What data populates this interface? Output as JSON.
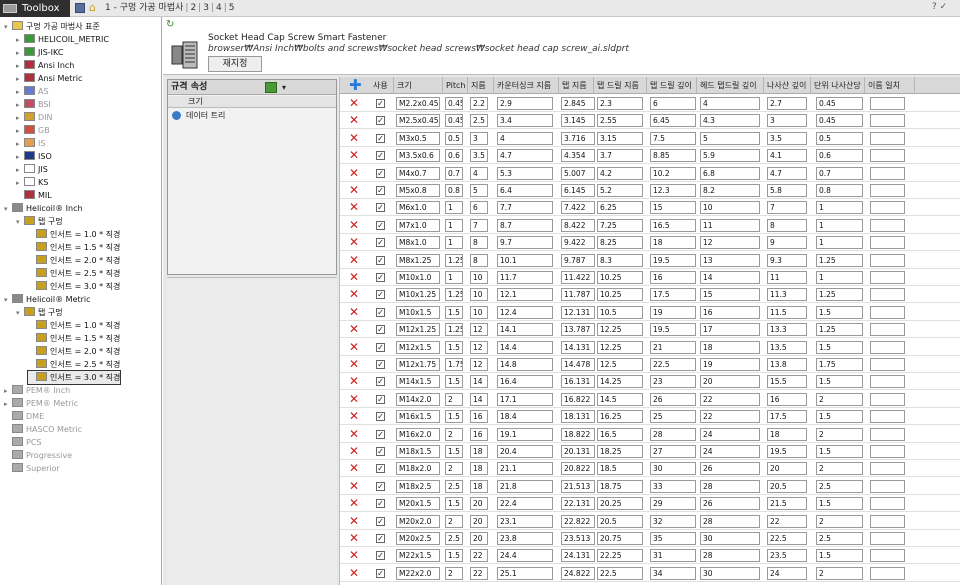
{
  "app": {
    "title": "Toolbox"
  },
  "breadcrumb": [
    "1 - 구멍 가공 마법사",
    "2",
    "3",
    "4",
    "5"
  ],
  "top_icons": "? ✓",
  "tree": [
    {
      "label": "구멍 가공 마법사 표준",
      "exp": "▾",
      "lvl": 0,
      "color": "#e8c84a",
      "dis": false
    },
    {
      "label": "HELICOIL_METRIC",
      "exp": "▸",
      "lvl": 1,
      "color": "#3a9a3a",
      "dis": false
    },
    {
      "label": "JIS-IKC",
      "exp": "▸",
      "lvl": 1,
      "color": "#3a9a3a",
      "dis": false
    },
    {
      "label": "Ansi Inch",
      "exp": "▸",
      "lvl": 1,
      "color": "#b03040",
      "dis": false
    },
    {
      "label": "Ansi Metric",
      "exp": "▸",
      "lvl": 1,
      "color": "#b03040",
      "dis": false
    },
    {
      "label": "AS",
      "exp": "▸",
      "lvl": 1,
      "color": "#6a7ad0",
      "dis": true
    },
    {
      "label": "BSI",
      "exp": "▸",
      "lvl": 1,
      "color": "#c05060",
      "dis": true
    },
    {
      "label": "DIN",
      "exp": "▸",
      "lvl": 1,
      "color": "#d0a030",
      "dis": true
    },
    {
      "label": "GB",
      "exp": "▸",
      "lvl": 1,
      "color": "#d05040",
      "dis": true
    },
    {
      "label": "IS",
      "exp": "▸",
      "lvl": 1,
      "color": "#e0a050",
      "dis": true
    },
    {
      "label": "ISO",
      "exp": "▸",
      "lvl": 1,
      "color": "#203a8a",
      "dis": false
    },
    {
      "label": "JIS",
      "exp": "▸",
      "lvl": 1,
      "color": "#ffffff",
      "dis": false
    },
    {
      "label": "KS",
      "exp": "▸",
      "lvl": 1,
      "color": "#ffffff",
      "dis": false
    },
    {
      "label": "MIL",
      "exp": "",
      "lvl": 1,
      "color": "#b03040",
      "dis": false
    },
    {
      "label": "Helicoil® Inch",
      "exp": "▾",
      "lvl": 0,
      "color": "#8a8a8a",
      "dis": false
    },
    {
      "label": "탭 구멍",
      "exp": "▾",
      "lvl": 1,
      "color": "#c8a020",
      "dis": false
    },
    {
      "label": "인서트 = 1.0 * 직경",
      "exp": "",
      "lvl": 2,
      "color": "#c8a020",
      "dis": false
    },
    {
      "label": "인서트 = 1.5 * 직경",
      "exp": "",
      "lvl": 2,
      "color": "#c8a020",
      "dis": false
    },
    {
      "label": "인서트 = 2.0 * 직경",
      "exp": "",
      "lvl": 2,
      "color": "#c8a020",
      "dis": false
    },
    {
      "label": "인서트 = 2.5 * 직경",
      "exp": "",
      "lvl": 2,
      "color": "#c8a020",
      "dis": false
    },
    {
      "label": "인서트 = 3.0 * 직경",
      "exp": "",
      "lvl": 2,
      "color": "#c8a020",
      "dis": false
    },
    {
      "label": "Helicoil® Metric",
      "exp": "▾",
      "lvl": 0,
      "color": "#8a8a8a",
      "dis": false
    },
    {
      "label": "탭 구멍",
      "exp": "▾",
      "lvl": 1,
      "color": "#c8a020",
      "dis": false
    },
    {
      "label": "인서트 = 1.0 * 직경",
      "exp": "",
      "lvl": 2,
      "color": "#c8a020",
      "dis": false
    },
    {
      "label": "인서트 = 1.5 * 직경",
      "exp": "",
      "lvl": 2,
      "color": "#c8a020",
      "dis": false
    },
    {
      "label": "인서트 = 2.0 * 직경",
      "exp": "",
      "lvl": 2,
      "color": "#c8a020",
      "dis": false
    },
    {
      "label": "인서트 = 2.5 * 직경",
      "exp": "",
      "lvl": 2,
      "color": "#c8a020",
      "dis": false
    },
    {
      "label": "인서트 = 3.0 * 직경",
      "exp": "",
      "lvl": 2,
      "color": "#c8a020",
      "dis": false,
      "sel": true
    },
    {
      "label": "PEM® Inch",
      "exp": "▸",
      "lvl": 0,
      "color": "#aaaaaa",
      "dis": true
    },
    {
      "label": "PEM® Metric",
      "exp": "▸",
      "lvl": 0,
      "color": "#aaaaaa",
      "dis": true
    },
    {
      "label": "DME",
      "exp": "",
      "lvl": 0,
      "color": "#aaaaaa",
      "dis": true
    },
    {
      "label": "HASCO Metric",
      "exp": "",
      "lvl": 0,
      "color": "#aaaaaa",
      "dis": true
    },
    {
      "label": "PCS",
      "exp": "",
      "lvl": 0,
      "color": "#aaaaaa",
      "dis": true
    },
    {
      "label": "Progressive",
      "exp": "",
      "lvl": 0,
      "color": "#aaaaaa",
      "dis": true
    },
    {
      "label": "Superior",
      "exp": "",
      "lvl": 0,
      "color": "#aaaaaa",
      "dis": true
    }
  ],
  "part": {
    "title": "Socket Head Cap Screw Smart Fastener",
    "path": "browser₩Ansi Inch₩bolts and screws₩socket head screws₩socket head cap screw_ai.sldprt",
    "reset_label": "재지정"
  },
  "props": {
    "header": "규격 속성",
    "row1": "크기",
    "row2": "데이터 트리"
  },
  "grid": {
    "columns": [
      "사용",
      "크기",
      "Pitch",
      "지름",
      "카운터싱크 지름",
      "탭 지름",
      "탭 드릴 지름",
      "탭 드릴 깊이",
      "헤드 탭드릴 깊이",
      "나사산 깊이",
      "단위 나사산당",
      "이름 일치"
    ],
    "rows": [
      [
        "M2.2x0.45",
        "0.45",
        "2.2",
        "2.9",
        "2.845",
        "2.3",
        "6",
        "4",
        "2.7",
        "0.45",
        ""
      ],
      [
        "M2.5x0.45",
        "0.45",
        "2.5",
        "3.4",
        "3.145",
        "2.55",
        "6.45",
        "4.3",
        "3",
        "0.45",
        ""
      ],
      [
        "M3x0.5",
        "0.5",
        "3",
        "4",
        "3.716",
        "3.15",
        "7.5",
        "5",
        "3.5",
        "0.5",
        ""
      ],
      [
        "M3.5x0.6",
        "0.6",
        "3.5",
        "4.7",
        "4.354",
        "3.7",
        "8.85",
        "5.9",
        "4.1",
        "0.6",
        ""
      ],
      [
        "M4x0.7",
        "0.7",
        "4",
        "5.3",
        "5.007",
        "4.2",
        "10.2",
        "6.8",
        "4.7",
        "0.7",
        ""
      ],
      [
        "M5x0.8",
        "0.8",
        "5",
        "6.4",
        "6.145",
        "5.2",
        "12.3",
        "8.2",
        "5.8",
        "0.8",
        ""
      ],
      [
        "M6x1.0",
        "1",
        "6",
        "7.7",
        "7.422",
        "6.25",
        "15",
        "10",
        "7",
        "1",
        ""
      ],
      [
        "M7x1.0",
        "1",
        "7",
        "8.7",
        "8.422",
        "7.25",
        "16.5",
        "11",
        "8",
        "1",
        ""
      ],
      [
        "M8x1.0",
        "1",
        "8",
        "9.7",
        "9.422",
        "8.25",
        "18",
        "12",
        "9",
        "1",
        ""
      ],
      [
        "M8x1.25",
        "1.25",
        "8",
        "10.1",
        "9.787",
        "8.3",
        "19.5",
        "13",
        "9.3",
        "1.25",
        ""
      ],
      [
        "M10x1.0",
        "1",
        "10",
        "11.7",
        "11.422",
        "10.25",
        "16",
        "14",
        "11",
        "1",
        ""
      ],
      [
        "M10x1.25",
        "1.25",
        "10",
        "12.1",
        "11.787",
        "10.25",
        "17.5",
        "15",
        "11.3",
        "1.25",
        ""
      ],
      [
        "M10x1.5",
        "1.5",
        "10",
        "12.4",
        "12.131",
        "10.5",
        "19",
        "16",
        "11.5",
        "1.5",
        ""
      ],
      [
        "M12x1.25",
        "1.25",
        "12",
        "14.1",
        "13.787",
        "12.25",
        "19.5",
        "17",
        "13.3",
        "1.25",
        ""
      ],
      [
        "M12x1.5",
        "1.5",
        "12",
        "14.4",
        "14.131",
        "12.25",
        "21",
        "18",
        "13.5",
        "1.5",
        ""
      ],
      [
        "M12x1.75",
        "1.75",
        "12",
        "14.8",
        "14.478",
        "12.5",
        "22.5",
        "19",
        "13.8",
        "1.75",
        ""
      ],
      [
        "M14x1.5",
        "1.5",
        "14",
        "16.4",
        "16.131",
        "14.25",
        "23",
        "20",
        "15.5",
        "1.5",
        ""
      ],
      [
        "M14x2.0",
        "2",
        "14",
        "17.1",
        "16.822",
        "14.5",
        "26",
        "22",
        "16",
        "2",
        ""
      ],
      [
        "M16x1.5",
        "1.5",
        "16",
        "18.4",
        "18.131",
        "16.25",
        "25",
        "22",
        "17.5",
        "1.5",
        ""
      ],
      [
        "M16x2.0",
        "2",
        "16",
        "19.1",
        "18.822",
        "16.5",
        "28",
        "24",
        "18",
        "2",
        ""
      ],
      [
        "M18x1.5",
        "1.5",
        "18",
        "20.4",
        "20.131",
        "18.25",
        "27",
        "24",
        "19.5",
        "1.5",
        ""
      ],
      [
        "M18x2.0",
        "2",
        "18",
        "21.1",
        "20.822",
        "18.5",
        "30",
        "26",
        "20",
        "2",
        ""
      ],
      [
        "M18x2.5",
        "2.5",
        "18",
        "21.8",
        "21.513",
        "18.75",
        "33",
        "28",
        "20.5",
        "2.5",
        ""
      ],
      [
        "M20x1.5",
        "1.5",
        "20",
        "22.4",
        "22.131",
        "20.25",
        "29",
        "26",
        "21.5",
        "1.5",
        ""
      ],
      [
        "M20x2.0",
        "2",
        "20",
        "23.1",
        "22.822",
        "20.5",
        "32",
        "28",
        "22",
        "2",
        ""
      ],
      [
        "M20x2.5",
        "2.5",
        "20",
        "23.8",
        "23.513",
        "20.75",
        "35",
        "30",
        "22.5",
        "2.5",
        ""
      ],
      [
        "M22x1.5",
        "1.5",
        "22",
        "24.4",
        "24.131",
        "22.25",
        "31",
        "28",
        "23.5",
        "1.5",
        ""
      ],
      [
        "M22x2.0",
        "2",
        "22",
        "25.1",
        "24.822",
        "22.5",
        "34",
        "30",
        "24",
        "2",
        ""
      ]
    ]
  }
}
